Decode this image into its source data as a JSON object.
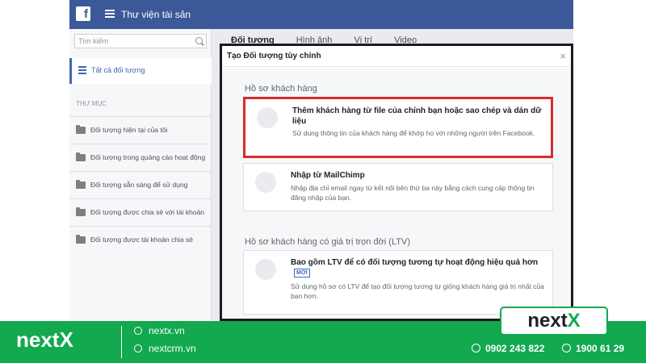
{
  "app": {
    "title": "Thư viện tài sản",
    "logo": "f"
  },
  "sidebar": {
    "search_placeholder": "Tìm kiếm",
    "all_label": "Tất cả đối tượng",
    "section": "THƯ MỤC",
    "folders": [
      "Đối tượng hiện tại của tôi",
      "Đối tượng trong quảng cáo hoạt động",
      "Đối tượng sẵn sàng để sử dụng",
      "Đối tượng được chia sẻ với tài khoản",
      "Đối tượng được tài khoản chia sẻ"
    ]
  },
  "tabs": [
    "Đối tượng",
    "Hình ảnh",
    "Vị trí",
    "Video"
  ],
  "modal": {
    "title": "Tạo Đối tượng tùy chỉnh",
    "group1": "Hồ sơ khách hàng",
    "group2": "Hồ sơ khách hàng có giá trị trọn đời (LTV)",
    "cards": [
      {
        "title": "Thêm khách hàng từ file của chính bạn hoặc sao chép và dán dữ liệu",
        "desc": "Sử dụng thông tin của khách hàng để khớp họ với những người trên Facebook."
      },
      {
        "title": "Nhập từ MailChimp",
        "desc": "Nhập địa chỉ email ngay từ kết nối bên thứ ba này bằng cách cung cấp thông tin đăng nhập của bạn."
      },
      {
        "title": "Bao gồm LTV để có đối tượng tương tự hoạt động hiệu quả hơn",
        "badge": "MỚI",
        "desc": "Sử dụng hồ sơ có LTV để tạo đối tượng tương tự giống khách hàng giá trị nhất của bạn hơn."
      }
    ]
  },
  "footer": {
    "brand": "nextX",
    "links": [
      "nextx.vn",
      "nextcrm.vn"
    ],
    "phones": [
      "0902 243 822",
      "1900 61 29"
    ],
    "logo_main": "next",
    "logo_x": "X",
    "colors": {
      "green": "#12a94f",
      "facebook_blue": "#3b5998",
      "highlight_red": "#d62d2d"
    }
  }
}
